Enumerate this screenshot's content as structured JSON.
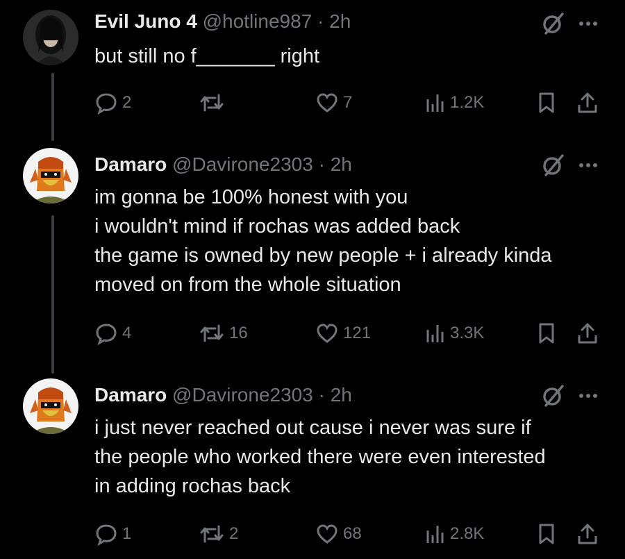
{
  "tweets": [
    {
      "display_name": "Evil Juno 4",
      "handle": "@hotline987",
      "time": "2h",
      "lines": [
        "but still no f_______ right"
      ],
      "replies": "2",
      "reposts": "",
      "likes": "7",
      "views": "1.2K"
    },
    {
      "display_name": "Damaro",
      "handle": "@Davirone2303",
      "time": "2h",
      "lines": [
        "im gonna be 100% honest with you",
        "i wouldn't mind if rochas was added back",
        "the game is owned by new people + i already kinda",
        "moved on from the whole situation"
      ],
      "replies": "4",
      "reposts": "16",
      "likes": "121",
      "views": "3.3K"
    },
    {
      "display_name": "Damaro",
      "handle": "@Davirone2303",
      "time": "2h",
      "lines": [
        "i just never reached out cause i never was sure if",
        "the people who worked there were even interested",
        "in adding rochas back"
      ],
      "replies": "1",
      "reposts": "2",
      "likes": "68",
      "views": "2.8K"
    }
  ],
  "separator": " · ",
  "colors": {
    "background": "#000000",
    "text": "#e7e9ea",
    "muted": "#71767b",
    "thread_line": "#3b3f44"
  },
  "icons": [
    "reply-icon",
    "repost-icon",
    "like-icon",
    "views-icon",
    "bookmark-icon",
    "share-icon",
    "grok-icon",
    "more-icon"
  ]
}
